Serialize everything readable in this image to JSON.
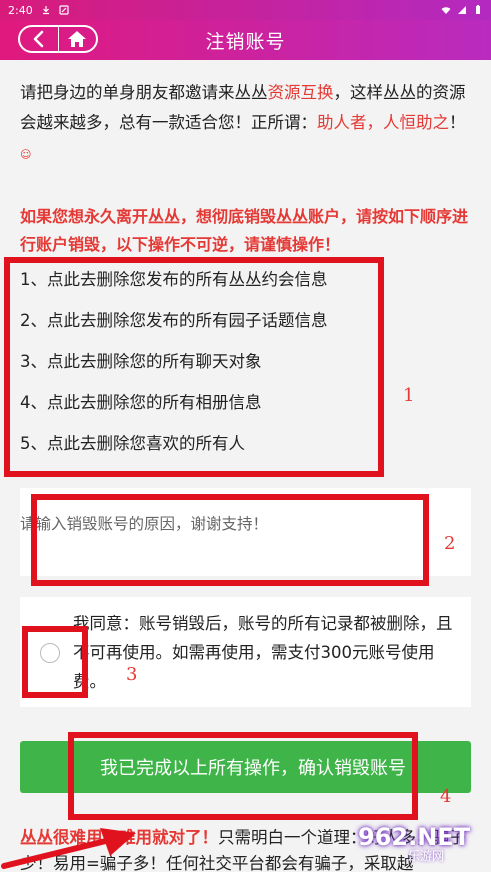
{
  "status_bar": {
    "time": "2:40"
  },
  "nav": {
    "title": "注销账号",
    "back_icon": "back-icon",
    "home_icon": "home-icon"
  },
  "intro": {
    "part1": "请把身边的单身朋友都邀请来丛丛",
    "link": "资源互换",
    "part2": "，这样丛丛的资源会越来越多，总有一款适合您！正所谓：",
    "highlight": "助人者，人恒助之",
    "end": "！"
  },
  "warning": "如果您想永久离开丛丛，想彻底销毁丛丛账户，请按如下顺序进行账户销毁，以下操作不可逆，请谨慎操作！",
  "steps": [
    "1、点此去删除您发布的所有丛丛约会信息",
    "2、点此去删除您发布的所有园子话题信息",
    "3、点此去删除您的所有聊天对象",
    "4、点此去删除您的所有相册信息",
    "5、点此去删除您喜欢的所有人"
  ],
  "reason": {
    "placeholder": "请输入销毁账号的原因，谢谢支持！"
  },
  "agree": {
    "text": "我同意：账号销毁后，账号的所有记录都被删除，且不可再使用。如需再使用，需支付300元账号使用费。"
  },
  "confirm_button": "我已完成以上所有操作，确认销毁账号",
  "bottom": {
    "strong": "丛丛很难用？难用就对了！",
    "rest": "只需明白一个道理：好人多，骗子少！易用=骗子多！任何社交平台都会有骗子，采取越"
  },
  "annotations": [
    "1",
    "2",
    "3",
    "4"
  ],
  "watermark": {
    "logo": "962.NET",
    "sub": "乐游网"
  },
  "colors": {
    "accent_gradient_start": "#e0197d",
    "accent_gradient_end": "#b92bbf",
    "warning_red": "#e53935",
    "confirm_green": "#3fb549",
    "annotation_red": "#e0121e"
  }
}
